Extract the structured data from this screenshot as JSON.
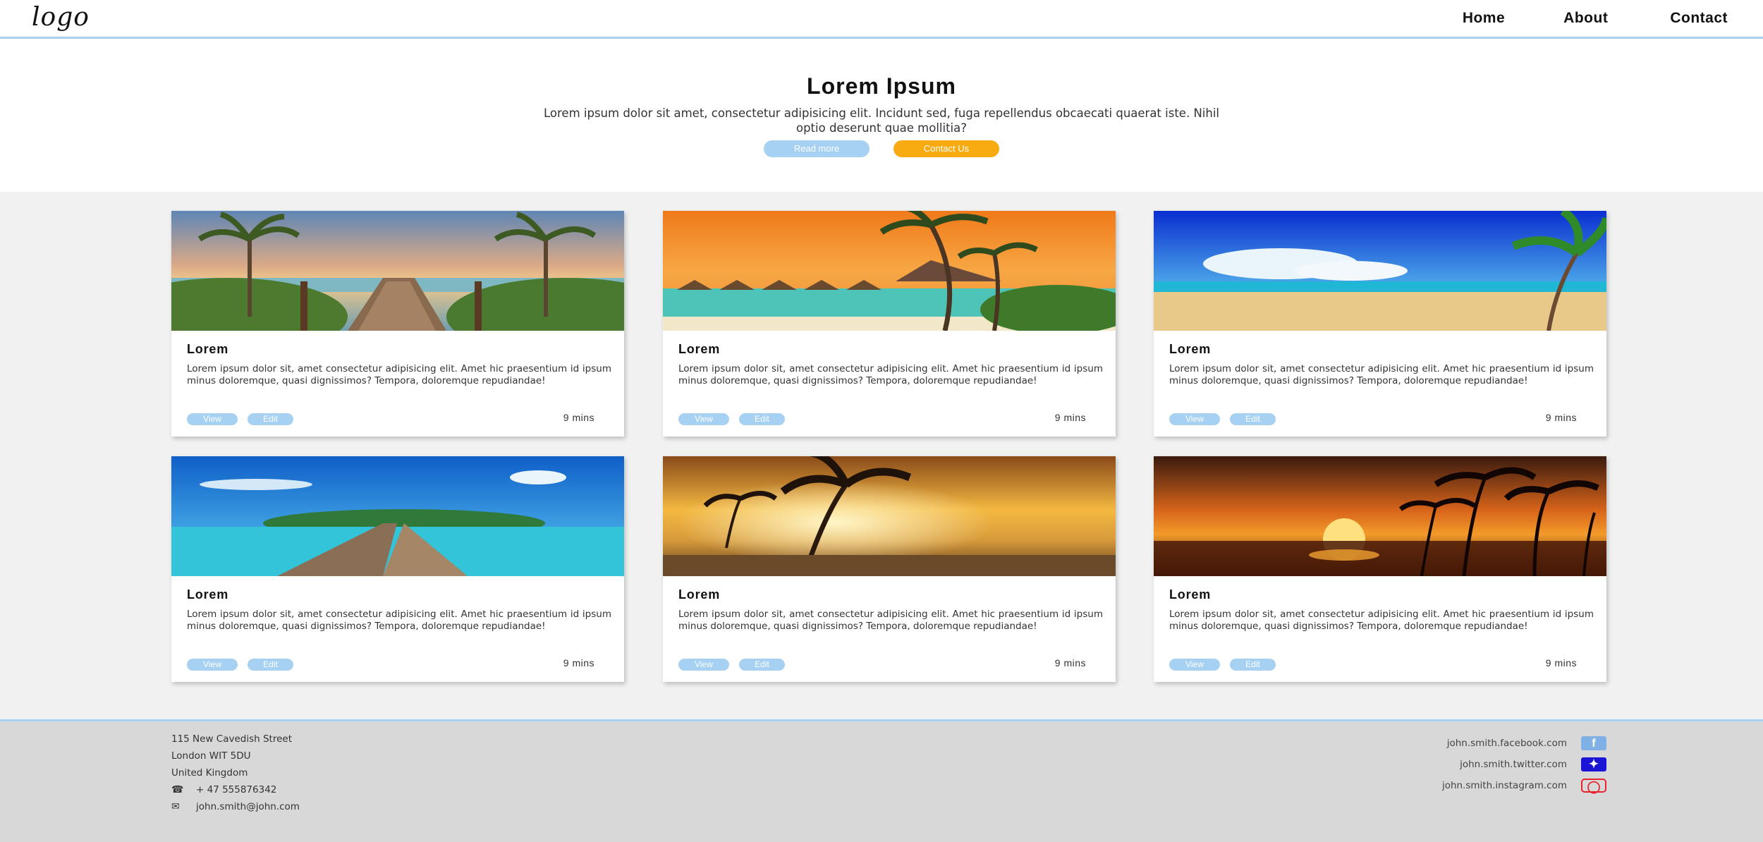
{
  "header": {
    "logo_text": "logo",
    "nav": [
      {
        "label": "Home"
      },
      {
        "label": "About"
      },
      {
        "label": "Contact"
      }
    ]
  },
  "hero": {
    "title": "Lorem Ipsum",
    "text": "Lorem ipsum dolor sit amet, consectetur adipisicing elit. Incidunt sed, fuga repellendus obcaecati quaerat iste. Nihil optio deserunt quae mollitia?",
    "read_more": "Read more",
    "contact_us": "Contact Us"
  },
  "cards": [
    {
      "title": "Lorem",
      "text": "Lorem ipsum dolor sit, amet consectetur adipisicing elit. Amet hic praesentium id ipsum minus doloremque, quasi dignissimos? Tempora, doloremque repudiandae!",
      "view": "View",
      "edit": "Edit",
      "time": "9 mins",
      "image": "beach-boardwalk-sunset"
    },
    {
      "title": "Lorem",
      "text": "Lorem ipsum dolor sit, amet consectetur adipisicing elit. Amet hic praesentium id ipsum minus doloremque, quasi dignissimos? Tempora, doloremque repudiandae!",
      "view": "View",
      "edit": "Edit",
      "time": "9 mins",
      "image": "tropical-overwater-bungalows"
    },
    {
      "title": "Lorem",
      "text": "Lorem ipsum dolor sit, amet consectetur adipisicing elit. Amet hic praesentium id ipsum minus doloremque, quasi dignissimos? Tempora, doloremque repudiandae!",
      "view": "View",
      "edit": "Edit",
      "time": "9 mins",
      "image": "sandy-beach-palm"
    },
    {
      "title": "Lorem",
      "text": "Lorem ipsum dolor sit, amet consectetur adipisicing elit. Amet hic praesentium id ipsum minus doloremque, quasi dignissimos? Tempora, doloremque repudiandae!",
      "view": "View",
      "edit": "Edit",
      "time": "9 mins",
      "image": "pier-to-island"
    },
    {
      "title": "Lorem",
      "text": "Lorem ipsum dolor sit, amet consectetur adipisicing elit. Amet hic praesentium id ipsum minus doloremque, quasi dignissimos? Tempora, doloremque repudiandae!",
      "view": "View",
      "edit": "Edit",
      "time": "9 mins",
      "image": "golden-sunset-beach"
    },
    {
      "title": "Lorem",
      "text": "Lorem ipsum dolor sit, amet consectetur adipisicing elit. Amet hic praesentium id ipsum minus doloremque, quasi dignissimos? Tempora, doloremque repudiandae!",
      "view": "View",
      "edit": "Edit",
      "time": "9 mins",
      "image": "red-sunset-palms"
    }
  ],
  "footer": {
    "address": [
      "115 New Cavedish Street",
      "London WIT 5DU",
      "United Kingdom"
    ],
    "phone": "+ 47 555876342",
    "email": "john.smith@john.com",
    "social": [
      {
        "label": "john.smith.facebook.com",
        "icon": "facebook-icon"
      },
      {
        "label": "john.smith.twitter.com",
        "icon": "twitter-icon"
      },
      {
        "label": "john.smith.instagram.com",
        "icon": "instagram-icon"
      }
    ]
  },
  "colors": {
    "accent_blue": "#a6d1f2",
    "accent_orange": "#f7ab11",
    "main_bg": "#f0f1f0",
    "footer_bg": "#d8d8d8"
  }
}
